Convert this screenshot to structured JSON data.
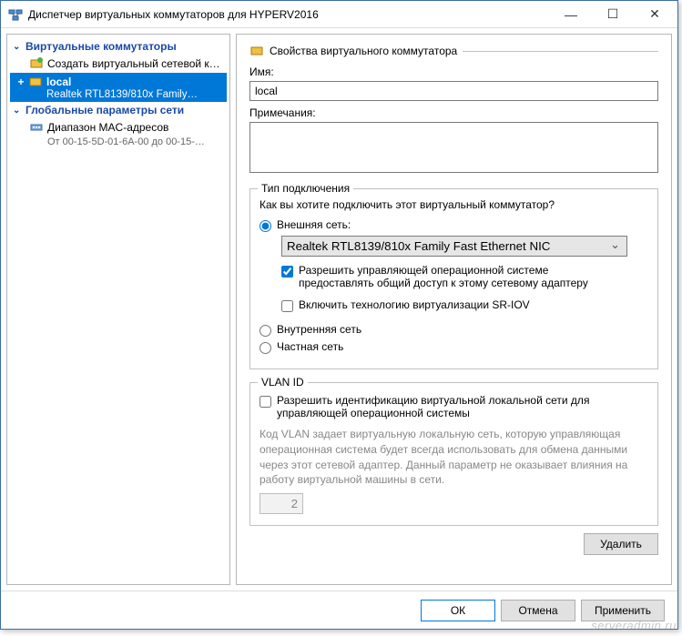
{
  "window": {
    "title": "Диспетчер виртуальных коммутаторов для HYPERV2016"
  },
  "sidebar": {
    "group1": "Виртуальные коммутаторы",
    "create": "Создать виртуальный сетевой к…",
    "local": "local",
    "local_sub": "Realtek RTL8139/810x Family…",
    "group2": "Глобальные параметры сети",
    "mac": "Диапазон MAC-адресов",
    "mac_sub": "От 00-15-5D-01-6A-00 до 00-15-…"
  },
  "panel": {
    "header": "Свойства виртуального коммутатора",
    "name_label": "Имя:",
    "name_value": "local",
    "notes_label": "Примечания:",
    "notes_value": "",
    "conn": {
      "legend": "Тип подключения",
      "question": "Как вы хотите подключить этот виртуальный коммутатор?",
      "external": "Внешняя сеть:",
      "adapter": "Realtek RTL8139/810x Family Fast Ethernet NIC",
      "allow_mgmt": "Разрешить управляющей операционной системе предоставлять общий доступ к этому сетевому адаптеру",
      "sriov": "Включить технологию виртуализации SR-IOV",
      "internal": "Внутренняя сеть",
      "private": "Частная сеть"
    },
    "vlan": {
      "legend": "VLAN ID",
      "enable": "Разрешить идентификацию виртуальной локальной сети для управляющей операционной системы",
      "desc": "Код VLAN задает виртуальную локальную сеть, которую управляющая операционная система будет всегда использовать для обмена данными через этот сетевой адаптер. Данный параметр не оказывает влияния на работу виртуальной машины в сети.",
      "value": "2"
    },
    "delete": "Удалить"
  },
  "footer": {
    "ok": "ОК",
    "cancel": "Отмена",
    "apply": "Применить"
  },
  "watermark": "serveradmin.ru"
}
